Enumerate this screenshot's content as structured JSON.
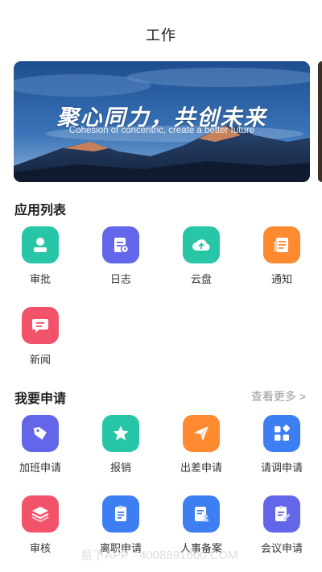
{
  "header": {
    "title": "工作"
  },
  "banner": {
    "headline": "聚心同力，共创未来",
    "subtitle": "Cohesion of concentric, create a better future"
  },
  "apps": {
    "title": "应用列表",
    "items": [
      {
        "label": "审批",
        "icon": "person-icon",
        "color": "#26c6a6"
      },
      {
        "label": "日志",
        "icon": "log-icon",
        "color": "#6366e8"
      },
      {
        "label": "云盘",
        "icon": "cloud-upload-icon",
        "color": "#26c6a6"
      },
      {
        "label": "通知",
        "icon": "notice-icon",
        "color": "#ff8a30"
      },
      {
        "label": "新闻",
        "icon": "chat-icon",
        "color": "#f2536a"
      }
    ]
  },
  "apply": {
    "title": "我要申请",
    "more": "查看更多 >",
    "items": [
      {
        "label": "加班申请",
        "icon": "tag-icon",
        "color": "#6366e8"
      },
      {
        "label": "报销",
        "icon": "star-icon",
        "color": "#26c6a6"
      },
      {
        "label": "出差申请",
        "icon": "paper-plane-icon",
        "color": "#ff8a30"
      },
      {
        "label": "请调申请",
        "icon": "grid-icon",
        "color": "#3d7ff2"
      },
      {
        "label": "审核",
        "icon": "layers-icon",
        "color": "#f2536a"
      },
      {
        "label": "离职申请",
        "icon": "document-icon",
        "color": "#3d7ff2"
      },
      {
        "label": "人事备案",
        "icon": "person-file-icon",
        "color": "#3d7ff2"
      },
      {
        "label": "会议申请",
        "icon": "edit-file-icon",
        "color": "#6366e8"
      }
    ]
  },
  "watermark": "易下APP · 4008891600.COM"
}
